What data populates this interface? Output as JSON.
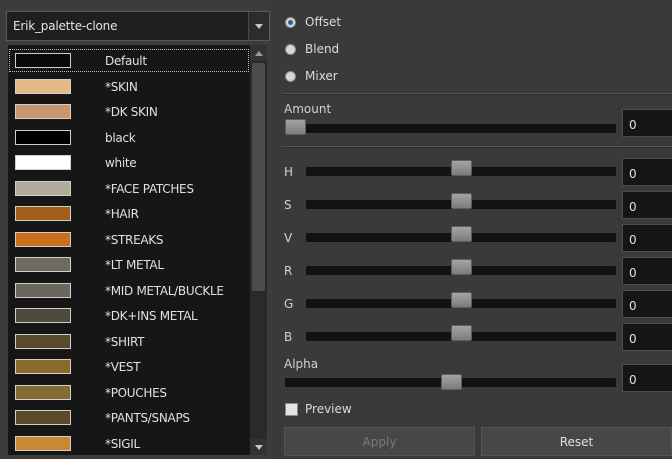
{
  "palette": {
    "selected": "Erik_palette-clone",
    "colors": [
      {
        "name": "Default",
        "color": "#0a0a0a",
        "selected": true
      },
      {
        "name": "*SKIN",
        "color": "#e6b788"
      },
      {
        "name": "*DK SKIN",
        "color": "#c8966e"
      },
      {
        "name": "black",
        "color": "#000000"
      },
      {
        "name": "white",
        "color": "#ffffff"
      },
      {
        "name": "*FACE PATCHES",
        "color": "#b0ab9a"
      },
      {
        "name": "*HAIR",
        "color": "#a35f18"
      },
      {
        "name": "*STREAKS",
        "color": "#c76f1c"
      },
      {
        "name": "*LT METAL",
        "color": "#6f6b62"
      },
      {
        "name": "*MID METAL/BUCKLE",
        "color": "#6b675c"
      },
      {
        "name": "*DK+INS METAL",
        "color": "#4e4a40"
      },
      {
        "name": "*SHIRT",
        "color": "#5a4a2a"
      },
      {
        "name": "*VEST",
        "color": "#8a6a2a"
      },
      {
        "name": "*POUCHES",
        "color": "#846a33"
      },
      {
        "name": "*PANTS/SNAPS",
        "color": "#5a4a28"
      },
      {
        "name": "*SIGIL",
        "color": "#c78a34"
      }
    ]
  },
  "mode": {
    "options": [
      "Offset",
      "Blend",
      "Mixer"
    ],
    "selected": "Offset"
  },
  "amount": {
    "label": "Amount",
    "value": "0",
    "level": 0.0
  },
  "channels": [
    {
      "label": "H",
      "value": "0",
      "level": 0.5
    },
    {
      "label": "S",
      "value": "0",
      "level": 0.5
    },
    {
      "label": "V",
      "value": "0",
      "level": 0.5
    },
    {
      "label": "R",
      "value": "0",
      "level": 0.5
    },
    {
      "label": "G",
      "value": "0",
      "level": 0.5
    },
    {
      "label": "B",
      "value": "0",
      "level": 0.5
    }
  ],
  "alpha": {
    "label": "Alpha",
    "value": "0",
    "level": 0.5
  },
  "preview": {
    "label": "Preview",
    "checked": false
  },
  "buttons": {
    "apply": "Apply",
    "reset": "Reset"
  },
  "icons": {
    "dropdown": "chevron-down-icon",
    "scroll_up": "arrow-up-icon",
    "scroll_down": "arrow-down-icon"
  },
  "colors": {
    "selected_radio": "#2f5f9e",
    "disabled_text": "#7a7a7a"
  }
}
